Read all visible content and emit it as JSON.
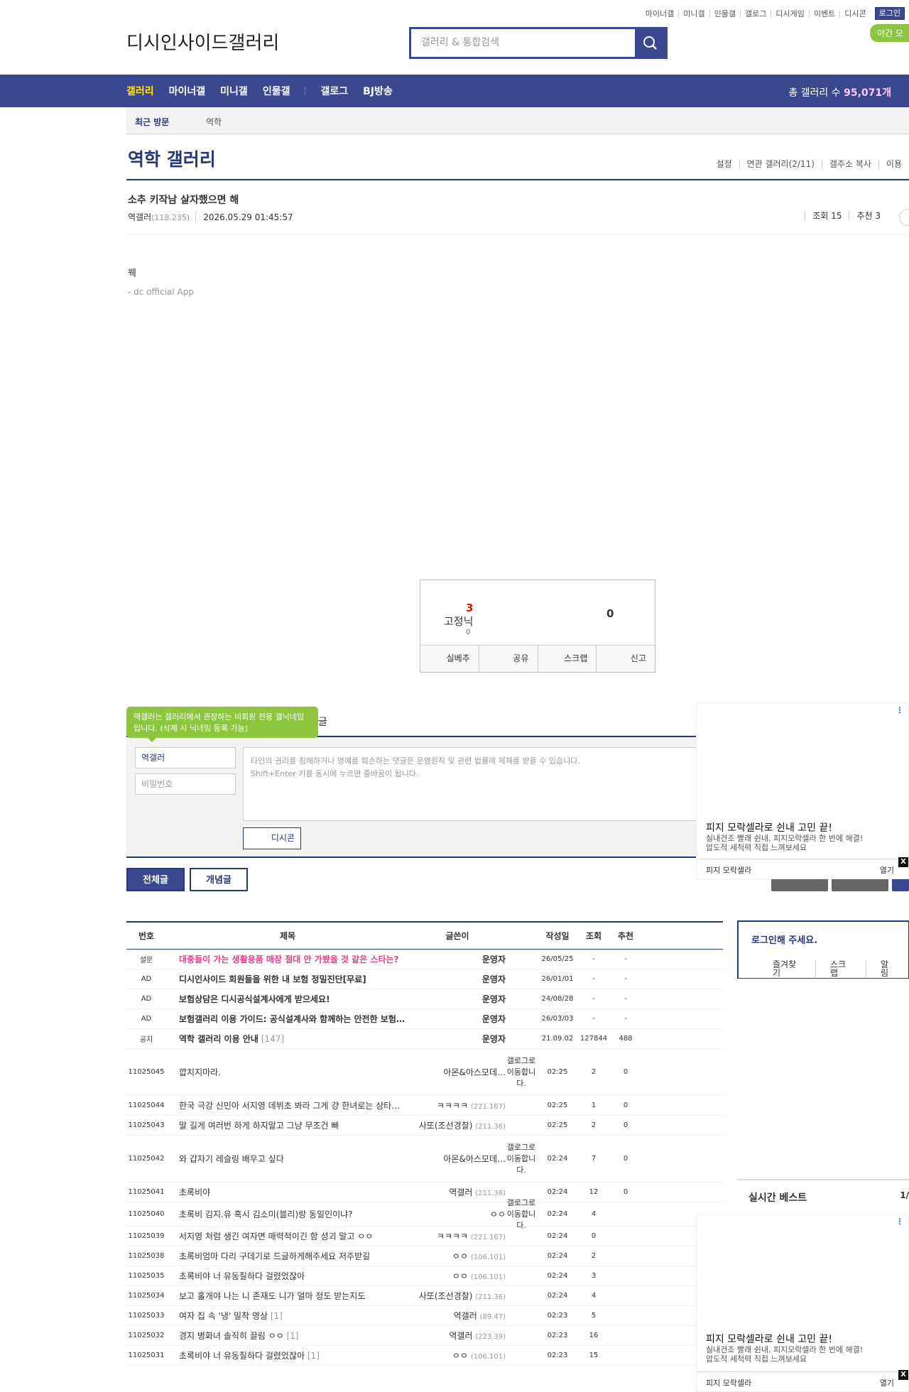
{
  "util": {
    "items": [
      "마이너갤",
      "미니갤",
      "인물갤",
      "갤로그",
      "디시게임",
      "이벤트",
      "디시콘"
    ],
    "login": "로그인",
    "night": "야간 모"
  },
  "header": {
    "logo_alt": "디시인사이드갤러리",
    "search_placeholder": "갤러리 & 통합검색"
  },
  "gnb": {
    "items": [
      "갤러리",
      "마이너갤",
      "미니갤",
      "인물갤",
      "갤로그",
      "BJ방송"
    ],
    "total_label": "총 갤러리 수 ",
    "total_value": "95,071개"
  },
  "visit": {
    "label": "최근 방문",
    "gallery": "역학"
  },
  "gallery": {
    "title": "역학 갤러리",
    "options": [
      "설정",
      "연관 갤러리(2/11)",
      "갤주소 복사",
      "이용"
    ]
  },
  "post": {
    "title": "소추 키작남 살자했으면 해",
    "author": "역갤러",
    "ip": "(118.235)",
    "date": "2026.05.29 01:45:57",
    "views": "조회 15",
    "recommend": "추천 3",
    "body": "웩",
    "footer": "- dc official App"
  },
  "recommend_box": {
    "up": "3",
    "fix_label": "고정닉",
    "fix_count": "0",
    "down": "0",
    "buttons": [
      "실베추",
      "공유",
      "스크랩",
      "신고"
    ]
  },
  "comment": {
    "tip": "역갤러는 갤러리에서 권장하는 비회원 전용 갤닉네임입니다. (삭제 시 닉네임 등록 가능)",
    "head": "글",
    "nick": "역갤러",
    "pw_placeholder": "비밀번호",
    "textarea_line1": "타인의 권리를 침해하거나 명예를 훼손하는 댓글은 운영원칙 및 관련 법률에 제재를 받을 수 있습니다.",
    "textarea_line2": "Shift+Enter 키를 동시에 누르면 줄바꿈이 됩니다.",
    "dcon": "디시콘"
  },
  "tabs": {
    "all": "전체글",
    "concept": "개념글"
  },
  "ad": {
    "headline": "피지 모락셀라로 쉰내 고민 끝!",
    "sub1": "실내건조 빨래 쉰내, 피지모락셀라 한 번에 해결!",
    "sub2": "압도적 세척력 직접 느껴보세요",
    "brand": "피지 모락셀라",
    "open": "열기",
    "close": "X"
  },
  "list": {
    "headers": [
      "번호",
      "제목",
      "글쓴이",
      "작성일",
      "조회",
      "추천"
    ],
    "gallog_img": "갤로그로 이동합니다.",
    "rows": [
      {
        "no": "설문",
        "title": "대중들이 가는 생활용품 매장 절대 안 가봤을 것 같은 스타는?",
        "style": "pk",
        "writer": "운영자",
        "ip": "",
        "date": "26/05/25",
        "views": "-",
        "rec": "-",
        "cnt": ""
      },
      {
        "no": "AD",
        "title": "디시인사이드 회원들을 위한 내 보험 정밀진단[무료]",
        "style": "w",
        "writer": "운영자",
        "ip": "",
        "date": "26/01/01",
        "views": "-",
        "rec": "-",
        "cnt": ""
      },
      {
        "no": "AD",
        "title": "보험상담은 디시공식설계사에게 받으세요!",
        "style": "w",
        "writer": "운영자",
        "ip": "",
        "date": "24/08/28",
        "views": "-",
        "rec": "-",
        "cnt": ""
      },
      {
        "no": "AD",
        "title": "보험갤러리 이용 가이드: 공식설계사와 함께하는 안전한 보험…",
        "style": "w",
        "writer": "운영자",
        "ip": "",
        "date": "26/03/03",
        "views": "-",
        "rec": "-",
        "cnt": ""
      },
      {
        "no": "공지",
        "title": "역학 갤러리 이용 안내",
        "style": "w",
        "writer": "운영자",
        "ip": "",
        "date": "21.09.02",
        "views": "127844",
        "rec": "488",
        "cnt": "[147]"
      },
      {
        "no": "11025045",
        "title": "깝치지마라.",
        "style": "",
        "writer": "아몬&아스모데…",
        "ip": "",
        "date": "02:25",
        "views": "2",
        "rec": "0",
        "cnt": "",
        "gallog": true
      },
      {
        "no": "11025044",
        "title": "한국 극강 신민아 서지영 데뷔초 봐라 그게 걍 한녀로는 상타…",
        "style": "",
        "writer": "ㅋㅋㅋㅋ",
        "ip": "(221.167)",
        "date": "02:25",
        "views": "1",
        "rec": "0",
        "cnt": ""
      },
      {
        "no": "11025043",
        "title": "말 길게 여러번 하게 하지말고 그냥 무조건 빠",
        "style": "",
        "writer": "사또(조선경찰)",
        "ip": "(211.36)",
        "date": "02:25",
        "views": "2",
        "rec": "0",
        "cnt": ""
      },
      {
        "no": "11025042",
        "title": "와 갑자기 레슬링 배우고 싶다",
        "style": "",
        "writer": "아몬&아스모데…",
        "ip": "",
        "date": "02:24",
        "views": "7",
        "rec": "0",
        "cnt": "",
        "gallog": true
      },
      {
        "no": "11025041",
        "title": "초록비야",
        "style": "",
        "writer": "역갤러",
        "ip": "(211.36)",
        "date": "02:24",
        "views": "12",
        "rec": "0",
        "cnt": ""
      },
      {
        "no": "11025040",
        "title": "초록비 김지.유 혹시 김소미(블리)랑 동일인이냐?",
        "style": "",
        "writer": "ㅇㅇ",
        "ip": "",
        "date": "02:24",
        "views": "4",
        "rec": "",
        "cnt": "",
        "gallog2": true
      },
      {
        "no": "11025039",
        "title": "서지영 처럼 생긴 여자면 매력적이긴 함 성괴 말고 ㅇㅇ",
        "style": "",
        "writer": "ㅋㅋㅋㅋ",
        "ip": "(221.167)",
        "date": "02:24",
        "views": "0",
        "rec": "",
        "cnt": ""
      },
      {
        "no": "11025038",
        "title": "초록비엄마 다리 구데기로 드글하게해주세요 저주받길",
        "style": "",
        "writer": "ㅇㅇ",
        "ip": "(106.101)",
        "date": "02:24",
        "views": "2",
        "rec": "",
        "cnt": ""
      },
      {
        "no": "11025035",
        "title": "초록비야 너 유동질하다 걸렸었잖아",
        "style": "",
        "writer": "ㅇㅇ",
        "ip": "(106.101)",
        "date": "02:24",
        "views": "3",
        "rec": "",
        "cnt": ""
      },
      {
        "no": "11025034",
        "title": "보고 홀개야 나는 니 존재도 니가 얼마 정도 받는지도",
        "style": "",
        "writer": "사또(조선경찰)",
        "ip": "(211.36)",
        "date": "02:24",
        "views": "4",
        "rec": "",
        "cnt": ""
      },
      {
        "no": "11025033",
        "title": "여자 집 속 '냉' 밀착 영상",
        "style": "",
        "writer": "역갤러",
        "ip": "(89.47)",
        "date": "02:23",
        "views": "5",
        "rec": "",
        "cnt": "[1]"
      },
      {
        "no": "11025032",
        "title": "경지 병화녀 솔직히 끌림 ㅇㅇ",
        "style": "",
        "writer": "역갤러",
        "ip": "(223.39)",
        "date": "02:23",
        "views": "16",
        "rec": "",
        "cnt": "[1]"
      },
      {
        "no": "11025031",
        "title": "초록비야 너 유동질하다 걸렸었잖아",
        "style": "",
        "writer": "ㅇㅇ",
        "ip": "(106.101)",
        "date": "02:23",
        "views": "15",
        "rec": "",
        "cnt": "[1]"
      }
    ]
  },
  "side": {
    "login_title": "로그인해 주세요.",
    "login_links": [
      "즐겨찾기",
      "스크랩",
      "알림"
    ],
    "best_title": "실시간 베스트",
    "best_page": "1/"
  }
}
